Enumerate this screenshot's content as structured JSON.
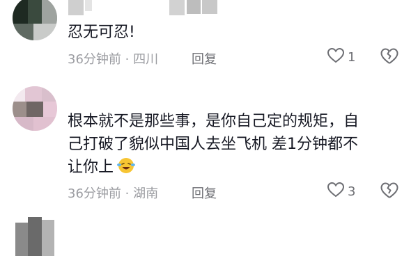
{
  "comments": [
    {
      "text": "忍无可忍!",
      "time": "36分钟前",
      "location": "四川",
      "reply_label": "回复",
      "likes": "1",
      "like_icon": "heart-outline-icon",
      "dislike_icon": "broken-heart-icon"
    },
    {
      "text_lines": [
        "根本就不是那些事，是你自己定的规矩，自",
        "己打破了貌似中国人去坐飞机 差1分钟都不",
        "让你上"
      ],
      "emoji": "crying-laughing-emoji",
      "time": "36分钟前",
      "location": "湖南",
      "reply_label": "回复",
      "likes": "3",
      "like_icon": "heart-outline-icon",
      "dislike_icon": "broken-heart-icon"
    }
  ],
  "meta_separator": "·"
}
